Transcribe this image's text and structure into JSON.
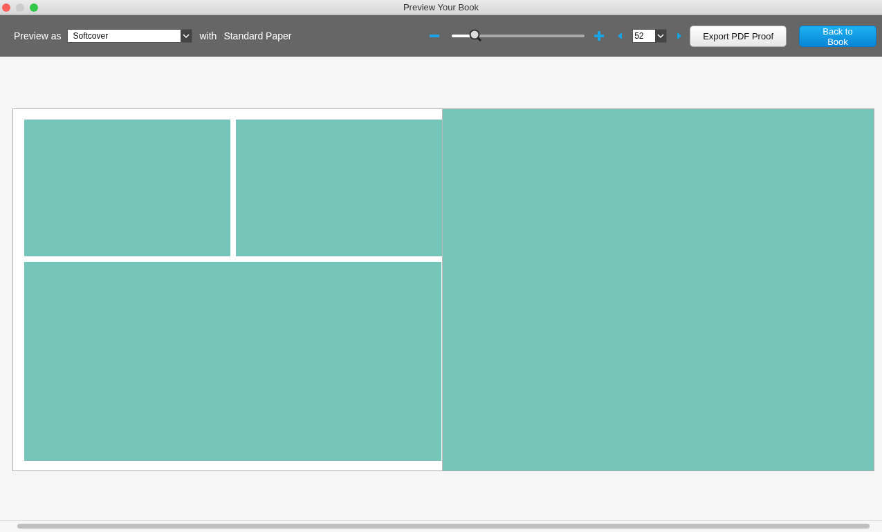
{
  "window": {
    "title": "Preview Your Book"
  },
  "toolbar": {
    "preview_label": "Preview as",
    "cover_select": {
      "value": "Softcover"
    },
    "with_label": "with",
    "paper_label": "Standard Paper",
    "zoom": {
      "level": 0.17
    },
    "page_select": {
      "value": "52"
    },
    "buttons": [
      {
        "label": "Export PDF Proof",
        "kind": "default"
      },
      {
        "label": "Back to Book",
        "kind": "primary"
      }
    ]
  }
}
